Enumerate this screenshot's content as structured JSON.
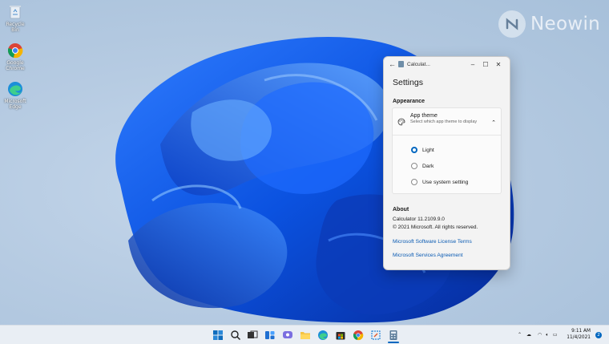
{
  "watermark": {
    "text": "Neowin"
  },
  "desktop": {
    "icons": [
      {
        "label": "Recycle Bin",
        "icon": "recycle-bin-icon"
      },
      {
        "label": "Google Chrome",
        "icon": "chrome-icon"
      },
      {
        "label": "Microsoft Edge",
        "icon": "edge-icon"
      }
    ]
  },
  "window": {
    "title": "Calculat...",
    "back_icon": "back-arrow-icon",
    "controls": {
      "minimize": "–",
      "maximize": "☐",
      "close": "✕"
    },
    "heading": "Settings",
    "appearance": {
      "section_label": "Appearance",
      "app_theme": {
        "title": "App theme",
        "description": "Select which app theme to display",
        "options": [
          {
            "label": "Light",
            "selected": true
          },
          {
            "label": "Dark",
            "selected": false
          },
          {
            "label": "Use system setting",
            "selected": false
          }
        ]
      }
    },
    "about": {
      "section_label": "About",
      "version": "Calculator 11.2109.9.0",
      "copyright": "© 2021 Microsoft. All rights reserved.",
      "links": [
        "Microsoft Software License Terms",
        "Microsoft Services Agreement"
      ]
    }
  },
  "taskbar": {
    "apps": [
      "start-icon",
      "search-icon",
      "task-view-icon",
      "widgets-icon",
      "chat-icon",
      "file-explorer-icon",
      "edge-icon",
      "store-icon",
      "chrome-icon",
      "snipping-tool-icon",
      "calculator-icon"
    ],
    "clock": {
      "time": "9:11 AM",
      "date": "11/4/2021"
    },
    "notification_count": "2",
    "accent": "#0067c0"
  }
}
